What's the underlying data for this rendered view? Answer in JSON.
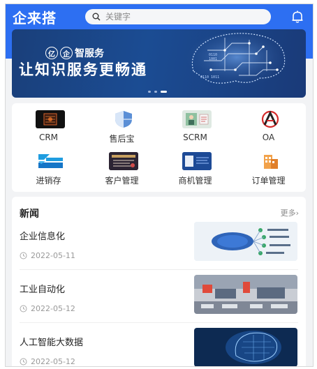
{
  "header": {
    "logo": "企来搭",
    "search_placeholder": "关键字"
  },
  "banner": {
    "brand_char1": "亿",
    "brand_char2": "企",
    "brand_rest": "智服务",
    "headline": "让知识服务更畅通"
  },
  "apps": [
    {
      "label": "CRM",
      "icon": "crm-icon"
    },
    {
      "label": "售后宝",
      "icon": "shield-icon"
    },
    {
      "label": "SCRM",
      "icon": "scrm-icon"
    },
    {
      "label": "OA",
      "icon": "oa-icon"
    },
    {
      "label": "进销存",
      "icon": "inventory-icon"
    },
    {
      "label": "客户管理",
      "icon": "customer-icon"
    },
    {
      "label": "商机管理",
      "icon": "opportunity-icon"
    },
    {
      "label": "订单管理",
      "icon": "order-icon"
    }
  ],
  "news": {
    "title": "新闻",
    "more": "更多",
    "items": [
      {
        "title": "企业信息化",
        "date": "2022-05-11"
      },
      {
        "title": "工业自动化",
        "date": "2022-05-12"
      },
      {
        "title": "人工智能大数据",
        "date": "2022-05-12"
      }
    ]
  },
  "colors": {
    "primary": "#2d6ff2"
  }
}
